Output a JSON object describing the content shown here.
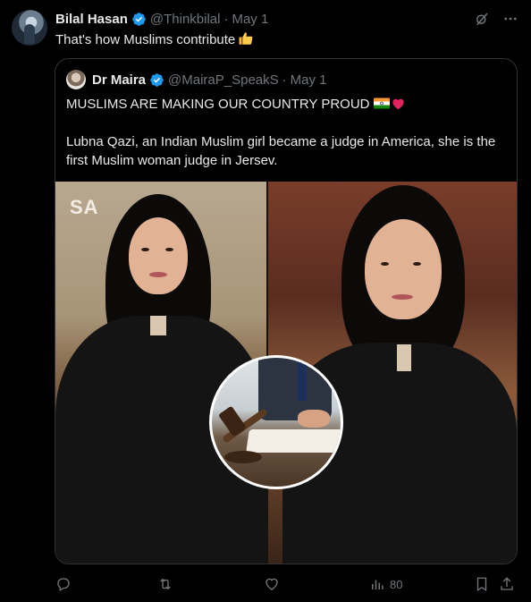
{
  "author": {
    "name": "Bilal Hasan",
    "handle": "@Thinkbilal",
    "separator": "·",
    "date": "May 1"
  },
  "tweet": {
    "text": "That's how Muslims contribute",
    "emoji": "thumbs-up"
  },
  "quoted": {
    "name": "Dr Maira",
    "handle": "@MairaP_SpeakS",
    "separator": "·",
    "date": "May 1",
    "line1": "MUSLIMS ARE MAKING OUR COUNTRY PROUD",
    "line1_emojis": [
      "india-flag",
      "red-heart"
    ],
    "line2": "Lubna Qazi, an Indian Muslim girl became a judge in America, she is the first Muslim woman judge in Jersev.",
    "image_watermark": "SA"
  },
  "actions": {
    "reply": "",
    "retweet": "",
    "like": "",
    "views": "80",
    "bookmark": "",
    "share": ""
  },
  "icons": {
    "top_right": [
      "grok-slash-icon",
      "more-icon"
    ],
    "verified": "verified-badge-icon"
  },
  "colors": {
    "background": "#000000",
    "text": "#e7e9ea",
    "muted": "#71767b",
    "verified": "#1d9bf0",
    "border": "#2f3336"
  }
}
